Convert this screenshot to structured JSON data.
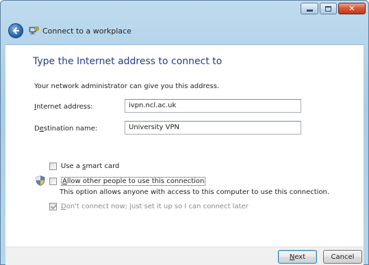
{
  "window": {
    "title": "Connect to a workplace",
    "colors": {
      "heading": "#1f3f89",
      "close": "#c1381b",
      "frame": "#a9cde6"
    }
  },
  "caption": {
    "minimize": "minimize-icon",
    "maximize": "maximize-icon",
    "close": "close-icon"
  },
  "main": {
    "heading": "Type the Internet address to connect to",
    "intro": "Your network administrator can give you this address.",
    "internet_address": {
      "label_pre": "",
      "label_key": "I",
      "label_post": "nternet address:",
      "value": "ivpn.ncl.ac.uk"
    },
    "destination_name": {
      "label_pre": "D",
      "label_key": "e",
      "label_post": "stination name:",
      "value": "University VPN"
    },
    "options": {
      "smart_card": {
        "pre": "Use a ",
        "key": "s",
        "post": "mart card",
        "checked": false
      },
      "allow_others": {
        "pre": "",
        "key": "A",
        "post": "llow other people to use this connection",
        "checked": false,
        "description": "This option allows anyone with access to this computer to use this connection."
      },
      "dont_connect": {
        "pre": "",
        "key": "D",
        "post": "on't connect now; just set it up so I can connect later",
        "checked": true,
        "enabled": false
      }
    }
  },
  "footer": {
    "next": {
      "pre": "",
      "key": "N",
      "post": "ext"
    },
    "cancel": "Cancel"
  }
}
